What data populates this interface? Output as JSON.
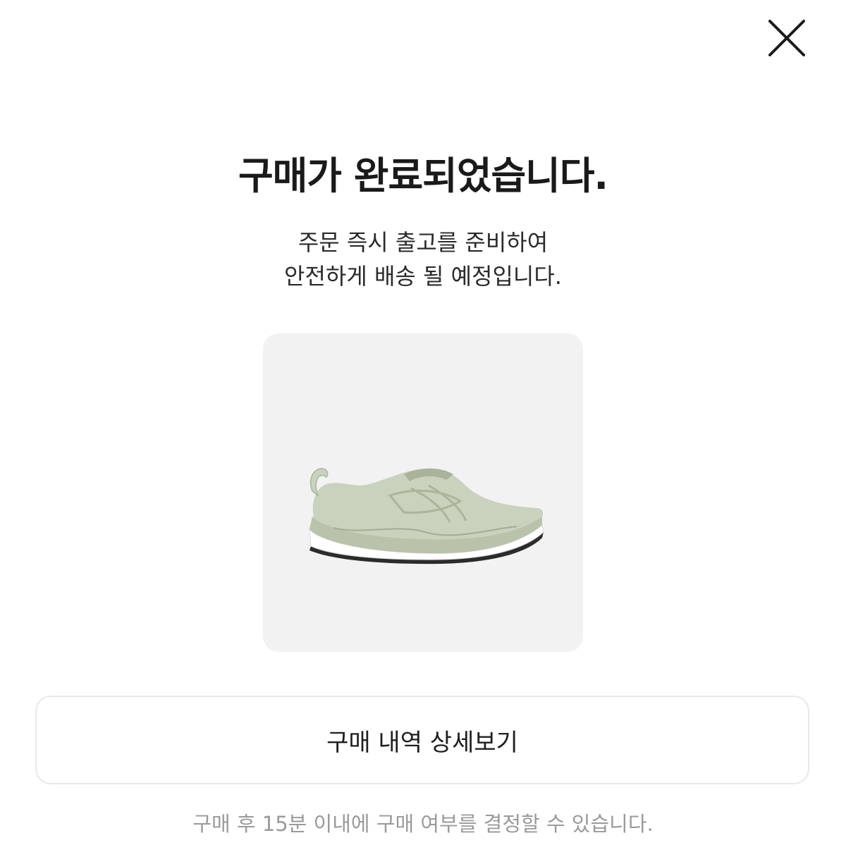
{
  "icons": {
    "close": "close-icon",
    "product_image": "sneaker-image"
  },
  "header": {
    "title": "구매가 완료되었습니다."
  },
  "message": {
    "line1": "주문 즉시 출고를 준비하여",
    "line2": "안전하게 배송 될 예정입니다."
  },
  "actions": {
    "detail_label": "구매 내역 상세보기"
  },
  "footer": {
    "notice": "구매 후 15분 이내에 구매 여부를 결정할 수 있습니다."
  },
  "colors": {
    "background": "#ffffff",
    "card_bg": "#f2f2f2",
    "title_text": "#1a1a1a",
    "notice_text": "#9a9a9a",
    "button_border": "#e8e8e8",
    "shoe_upper": "#c9d2bd",
    "shoe_sole": "#ffffff"
  }
}
